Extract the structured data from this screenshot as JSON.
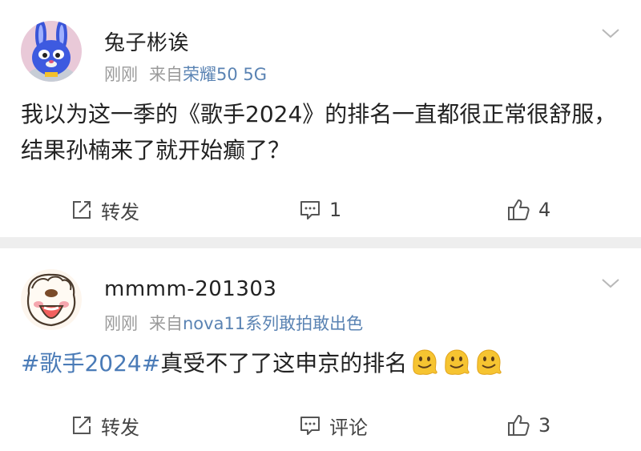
{
  "posts": [
    {
      "username": "兔子彬诶",
      "time": "刚刚",
      "source_prefix": "来自",
      "source": "荣耀50 5G",
      "text": "我以为这一季的《歌手2024》的排名一直都很正常很舒服，结果孙楠来了就开始癫了？",
      "actions": {
        "repost": "转发",
        "comment": "1",
        "like": "4"
      },
      "avatar_icon": "bunny-avatar"
    },
    {
      "username": "mmmm-201303",
      "time": "刚刚",
      "source_prefix": "来自",
      "source": "nova11系列敢拍敢出色",
      "hashtag": "#歌手2024#",
      "text": "真受不了了这申京的排名",
      "emoji_icon": "melting-face-emoji",
      "emoji_count": 3,
      "actions": {
        "repost": "转发",
        "comment": "评论",
        "like": "3"
      },
      "avatar_icon": "cartoon-face-avatar"
    }
  ],
  "colors": {
    "link": "#4a7bb7",
    "source": "#5a83b3",
    "meta": "#9a9a9a",
    "divider": "#eeeeee"
  }
}
